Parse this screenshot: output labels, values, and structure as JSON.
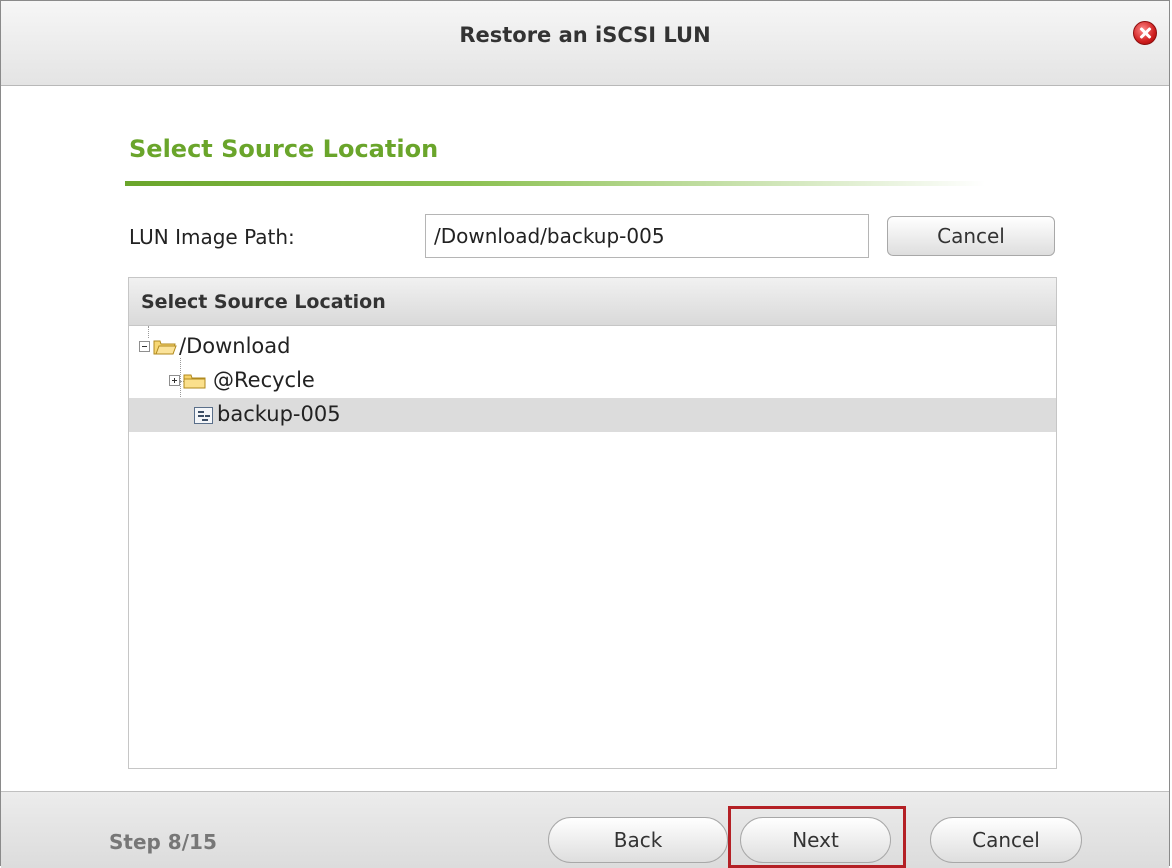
{
  "dialog": {
    "title": "Restore an iSCSI LUN",
    "close_icon": "close-icon"
  },
  "section": {
    "title": "Select Source Location"
  },
  "path": {
    "label": "LUN Image Path:",
    "value": "/Download/backup-005",
    "cancel_label": "Cancel"
  },
  "tree": {
    "header": "Select Source Location",
    "items": [
      {
        "label": "/Download",
        "icon": "folder-open-icon",
        "expander": "collapse",
        "selected": false
      },
      {
        "label": "@Recycle",
        "icon": "folder-icon",
        "expander": "expand",
        "selected": false
      },
      {
        "label": "backup-005",
        "icon": "file-icon",
        "expander": null,
        "selected": true
      }
    ]
  },
  "footer": {
    "step": "Step 8/15",
    "back_label": "Back",
    "next_label": "Next",
    "cancel_label": "Cancel"
  },
  "colors": {
    "accent_green": "#6aa52b",
    "highlight_red": "#b42025",
    "selected_row": "#dcdcdc"
  }
}
